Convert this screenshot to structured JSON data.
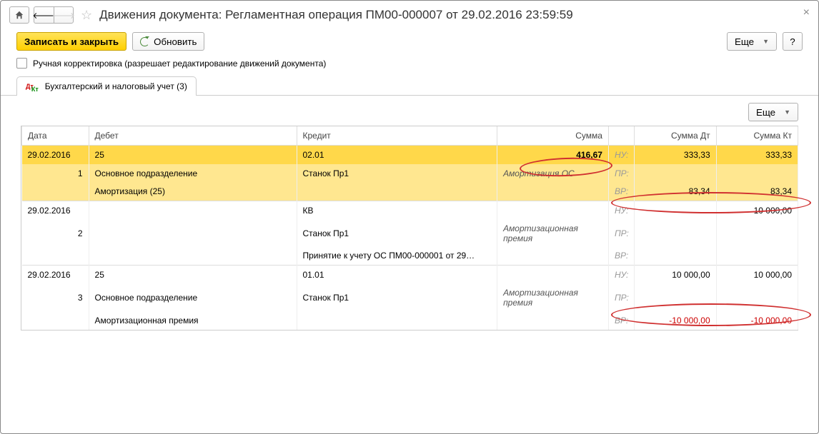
{
  "title": "Движения документа: Регламентная операция ПМ00-000007 от 29.02.2016 23:59:59",
  "toolbar": {
    "save_close": "Записать и закрыть",
    "refresh": "Обновить",
    "more": "Еще",
    "help": "?"
  },
  "checkbox_label": "Ручная корректировка (разрешает редактирование движений документа)",
  "tab_label": "Бухгалтерский и налоговый учет (3)",
  "sub_more": "Еще",
  "cols": {
    "date": "Дата",
    "debit": "Дебет",
    "credit": "Кредит",
    "sum": "Сумма",
    "dt": "Сумма Дт",
    "kt": "Сумма Кт"
  },
  "labels": {
    "nu": "НУ:",
    "pr": "ПР:",
    "vr": "ВР:"
  },
  "entries": [
    {
      "selected": true,
      "date": "29.02.2016",
      "num": "1",
      "debit_acc": "25",
      "debit_sub1": "Основное подразделение",
      "debit_sub2": "Амортизация (25)",
      "credit_acc": "02.01",
      "credit_sub1": "Станок Пр1",
      "credit_sub2": "",
      "sum": "416,67",
      "desc": "Амортизация ОС",
      "nu_dt": "333,33",
      "nu_kt": "333,33",
      "pr_dt": "",
      "pr_kt": "",
      "vr_dt": "83,34",
      "vr_kt": "83,34"
    },
    {
      "selected": false,
      "date": "29.02.2016",
      "num": "2",
      "debit_acc": "",
      "debit_sub1": "",
      "debit_sub2": "",
      "credit_acc": "КВ",
      "credit_sub1": "Станок Пр1",
      "credit_sub2": "Принятие к учету ОС ПМ00-000001 от 29…",
      "sum": "",
      "desc": "Амортизационная премия",
      "nu_dt": "",
      "nu_kt": "10 000,00",
      "pr_dt": "",
      "pr_kt": "",
      "vr_dt": "",
      "vr_kt": ""
    },
    {
      "selected": false,
      "date": "29.02.2016",
      "num": "3",
      "debit_acc": "25",
      "debit_sub1": "Основное подразделение",
      "debit_sub2": "Амортизационная премия",
      "credit_acc": "01.01",
      "credit_sub1": "Станок Пр1",
      "credit_sub2": "",
      "sum": "",
      "desc": "Амортизационная премия",
      "nu_dt": "10 000,00",
      "nu_kt": "10 000,00",
      "pr_dt": "",
      "pr_kt": "",
      "vr_dt": "-10 000,00",
      "vr_kt": "-10 000,00",
      "vr_neg": true
    }
  ]
}
